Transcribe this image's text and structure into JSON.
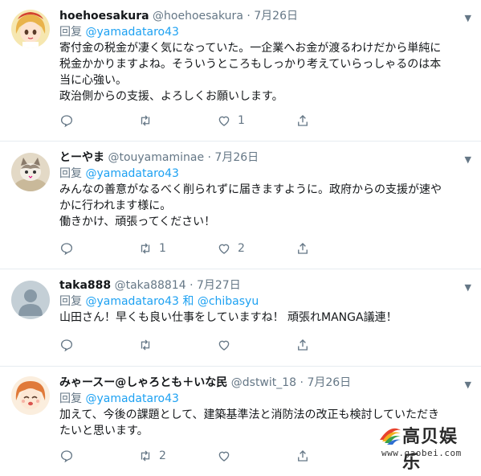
{
  "tweets": [
    {
      "name": "hoehoesakura",
      "handle": "@hoehoesakura",
      "separator": "·",
      "date": "7月26日",
      "reply_prefix": "回复",
      "reply_to": "@yamadataro43",
      "reply_joiner": "",
      "reply_to_2": "",
      "text": "寄付金の税金が凄く気になっていた。一企業へお金が渡るわけだから単純に\n税金かかりますよね。そういうところもしっかり考えていらっしゃるのは本\n当に心強い。\n政治側からの支援、よろしくお願いします。",
      "retweets": "",
      "likes": "1",
      "avatar_icon": "anime-girl-avatar"
    },
    {
      "name": "とーやま",
      "handle": "@touyamaminae",
      "separator": "·",
      "date": "7月26日",
      "reply_prefix": "回复",
      "reply_to": "@yamadataro43",
      "reply_joiner": "",
      "reply_to_2": "",
      "text": "みんなの善意がなるべく削られずに届きますように。政府からの支援が速や\nかに行われます様に。\n働きかけ、頑張ってください！",
      "retweets": "1",
      "likes": "2",
      "avatar_icon": "cat-avatar"
    },
    {
      "name": "taka888",
      "handle": "@taka88814",
      "separator": "·",
      "date": "7月27日",
      "reply_prefix": "回复",
      "reply_to": "@yamadataro43",
      "reply_joiner": "和",
      "reply_to_2": "@chibasyu",
      "text": "山田さん！早くも良い仕事をしていますね！ 頑張れMANGA議連！",
      "retweets": "",
      "likes": "",
      "avatar_icon": "default-user-avatar"
    },
    {
      "name": "みゃースー@しゃろとも＋いな民",
      "handle": "@dstwit_18",
      "separator": "·",
      "date": "7月26日",
      "reply_prefix": "回复",
      "reply_to": "@yamadataro43",
      "reply_joiner": "",
      "reply_to_2": "",
      "text": "加えて、今後の課題として、建築基準法と消防法の改正も検討していただき\nたいと思います。",
      "retweets": "2",
      "likes": "",
      "avatar_icon": "anime-girl-avatar"
    }
  ],
  "watermark": {
    "name": "高贝娱乐",
    "url": "www.gaobei.com"
  },
  "colors": {
    "link": "#1da1f2",
    "secondary": "#657786",
    "divider": "#e6ecf0"
  }
}
